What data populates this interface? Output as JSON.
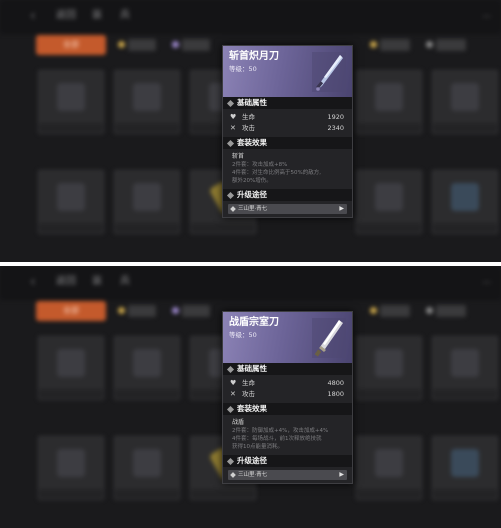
{
  "colors": {
    "tab_active": "#c45a2c",
    "tooltip_header_purple": "#6d6599",
    "section_bar": "#161618",
    "upgrade_bar": "#4a4a4f"
  },
  "panels": [
    {
      "background": {
        "header_items": [
          "返回",
          "装",
          "兵"
        ],
        "active_tab": "全部",
        "right_text": "..."
      },
      "tooltip": {
        "name": "斩首炽月刀",
        "level": "等级：50",
        "art_icon": "blade-icon",
        "sections": {
          "base": "基础属性",
          "set": "套装效果",
          "upgrade": "升级途径"
        },
        "stats": [
          {
            "icon": "heart-icon",
            "label": "生命",
            "value": "1920"
          },
          {
            "icon": "swords-icon",
            "label": "攻击",
            "value": "2340"
          }
        ],
        "set_name": "斩首",
        "set_lines": [
          "2件套：攻击加成+8%",
          "4件套：对生命比例高于50%的敌方,",
          "额外20%增伤。"
        ],
        "upgrade_path": "三山里·青七"
      }
    },
    {
      "background": {
        "header_items": [
          "返回",
          "装",
          "兵"
        ],
        "active_tab": "全部",
        "right_text": "..."
      },
      "tooltip": {
        "name": "战盾宗室刀",
        "level": "等级：50",
        "art_icon": "sword-icon",
        "sections": {
          "base": "基础属性",
          "set": "套装效果",
          "upgrade": "升级途径"
        },
        "stats": [
          {
            "icon": "heart-icon",
            "label": "生命",
            "value": "4800"
          },
          {
            "icon": "swords-icon",
            "label": "攻击",
            "value": "1800"
          }
        ],
        "set_name": "战盾",
        "set_lines": [
          "2件套：防御加成+4%，攻击加成+4%",
          "4件套：每场战斗，前1次释放绝技就",
          "获得10点能量消耗。"
        ],
        "upgrade_path": "三山里·青七"
      }
    }
  ]
}
